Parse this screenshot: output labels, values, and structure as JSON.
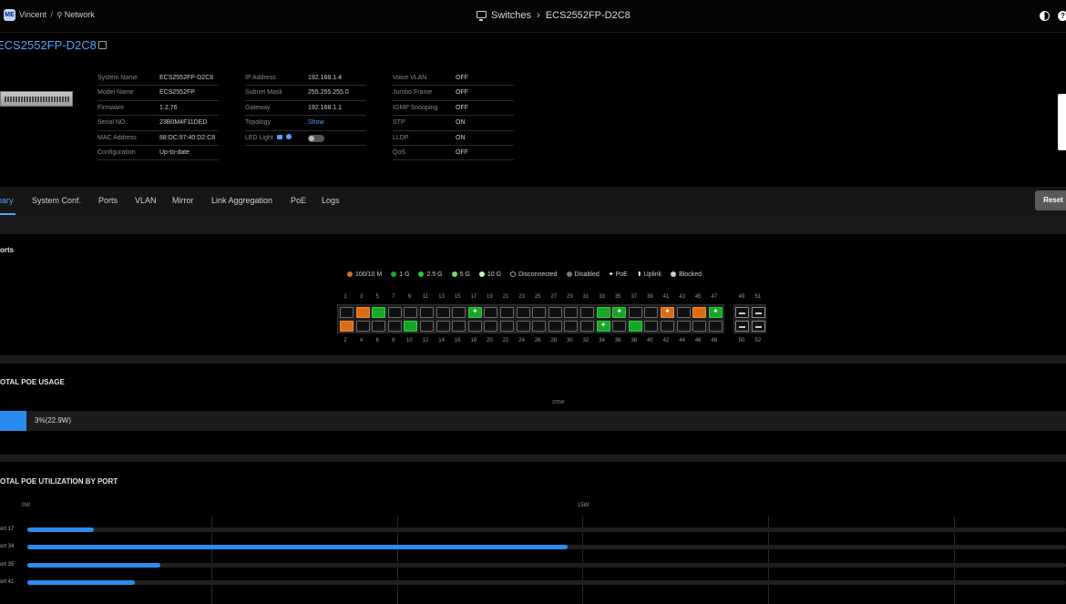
{
  "breadcrumb": {
    "org": "Vincent",
    "network": "Network",
    "logo": "ME"
  },
  "header": {
    "section": "Switches",
    "device": "ECS2552FP-D2C8"
  },
  "device": {
    "name": "ECS2552FP-D2C8"
  },
  "info": {
    "col1": [
      {
        "k": "System Name",
        "v": "ECS2552FP-D2C8"
      },
      {
        "k": "Model Name",
        "v": "ECS2552FP"
      },
      {
        "k": "Firmware",
        "v": "1.2.76"
      },
      {
        "k": "Serial NO.",
        "v": "23B0M4F11DED"
      },
      {
        "k": "MAC Address",
        "v": "88:DC:97:40:D2:C8"
      },
      {
        "k": "Configuration",
        "v": "Up-to-date"
      }
    ],
    "col2": [
      {
        "k": "IP Address",
        "v": "192.168.1.4"
      },
      {
        "k": "Subnet Mask",
        "v": "255.255.255.0"
      },
      {
        "k": "Gateway",
        "v": "192.168.1.1"
      },
      {
        "k": "Topology",
        "v": "Show"
      },
      {
        "k": "LED Light",
        "v": ""
      }
    ],
    "col3": [
      {
        "k": "Voice VLAN",
        "v": "OFF"
      },
      {
        "k": "Jumbo Frame",
        "v": "OFF"
      },
      {
        "k": "IGMP Snooping",
        "v": "OFF"
      },
      {
        "k": "STP",
        "v": "ON"
      },
      {
        "k": "LLDP",
        "v": "ON"
      },
      {
        "k": "QoS",
        "v": "OFF"
      }
    ]
  },
  "tabs": [
    "nary",
    "System Conf.",
    "Ports",
    "VLAN",
    "Mirror",
    "Link Aggregation",
    "PoE",
    "Logs"
  ],
  "reset_label": "Reset",
  "ports_section": {
    "title": "orts",
    "legend": [
      {
        "label": "100/10 M",
        "color": "#d96d18"
      },
      {
        "label": "1 G",
        "color": "#17a62a"
      },
      {
        "label": "2.5 G",
        "color": "#2fc23a"
      },
      {
        "label": "5 G",
        "color": "#6fe06a"
      },
      {
        "label": "10 G",
        "color": "#c8f5b8"
      },
      {
        "label": "Disconnected",
        "color": "#000000"
      },
      {
        "label": "Disabled",
        "color": "#777777"
      },
      {
        "label": "PoE",
        "color": ""
      },
      {
        "label": "Uplink",
        "color": ""
      },
      {
        "label": "Blocked",
        "color": "#cccccc"
      }
    ],
    "top_numbers": [
      "1",
      "3",
      "5",
      "7",
      "9",
      "11",
      "13",
      "15",
      "17",
      "19",
      "21",
      "23",
      "25",
      "27",
      "29",
      "31",
      "33",
      "35",
      "37",
      "39",
      "41",
      "43",
      "45",
      "47"
    ],
    "bottom_numbers": [
      "2",
      "4",
      "6",
      "8",
      "10",
      "12",
      "14",
      "16",
      "18",
      "20",
      "22",
      "24",
      "26",
      "28",
      "30",
      "32",
      "34",
      "36",
      "38",
      "40",
      "42",
      "44",
      "46",
      "48"
    ],
    "uplink_top": [
      "49",
      "51"
    ],
    "uplink_bottom": [
      "50",
      "52"
    ],
    "top_ports": [
      "off",
      "100",
      "1g",
      "off",
      "off",
      "off",
      "off",
      "off",
      "1g-poe",
      "off",
      "off",
      "off",
      "off",
      "off",
      "off",
      "off",
      "1g",
      "1g-poe",
      "off",
      "off",
      "100-poe",
      "off",
      "100",
      "1g-poe"
    ],
    "bottom_ports": [
      "100",
      "off",
      "off",
      "off",
      "1g",
      "off",
      "off",
      "off",
      "off",
      "off",
      "off",
      "off",
      "off",
      "off",
      "off",
      "off",
      "1g-poe",
      "off",
      "1g",
      "off",
      "off",
      "off",
      "off",
      "off"
    ]
  },
  "poe_usage": {
    "title": "OTAL POE USAGE",
    "max_label": "370W",
    "label": "3%(22.9W)",
    "percent": 2.5
  },
  "poe_util": {
    "title": "OTAL POE UTILIZATION BY PORT",
    "axis": [
      "0W",
      "15W"
    ],
    "axis_max_w": 28,
    "ports": [
      {
        "label": "ort 17",
        "watts": 1.8
      },
      {
        "label": "ort 34",
        "watts": 14.6
      },
      {
        "label": "ort 35",
        "watts": 3.6
      },
      {
        "label": "ort 41",
        "watts": 2.9
      }
    ]
  }
}
